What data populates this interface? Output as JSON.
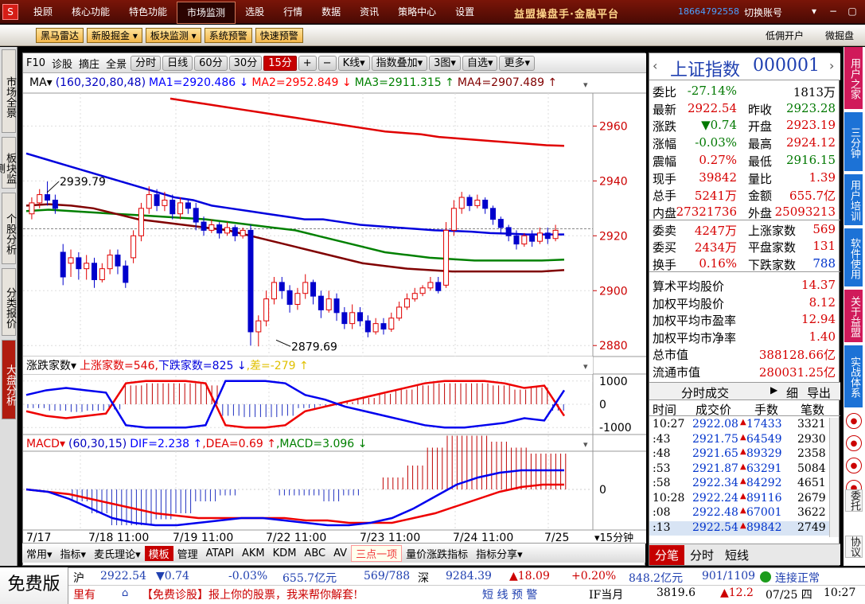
{
  "topbar": {
    "logo": "S",
    "menu": [
      "投顾",
      "核心功能",
      "特色功能",
      "市场监测",
      "选股",
      "行情",
      "数据",
      "资讯",
      "策略中心",
      "设置"
    ],
    "selected": "市场监测",
    "brand": "益盟操盘手·金融平台",
    "phone": "18664792558",
    "switch_account": "切换账号",
    "win": [
      "▾",
      "−",
      "▢",
      "✕"
    ]
  },
  "toolbar2": {
    "buttons": [
      "黑马雷达",
      "新股掘金",
      "板块监测",
      "系统预警",
      "快速预警"
    ],
    "open_account": "低佣开户",
    "weixin": "微掘盘"
  },
  "lefttabs": [
    "市场全景",
    "板块监测",
    "个股分析",
    "分类报价",
    "大盘分析"
  ],
  "righttabs": [
    "用户之家",
    "三分钟",
    "用户培训",
    "软件使用",
    "关于益盟",
    "实战体系"
  ],
  "righticons": [
    "委托",
    "协议"
  ],
  "chartbar": {
    "items": [
      "F10",
      "诊股",
      "摘庄",
      "全景"
    ],
    "periods": [
      "分时",
      "日线",
      "60分",
      "30分",
      "15分"
    ],
    "selected_period": "15分",
    "kline": "K线▾",
    "overlay": "指数叠加▾",
    "figs": "3图▾",
    "custom": "自选▾",
    "more": "更多▾"
  },
  "ma_legend": {
    "prefix": "MA▾",
    "params": "(160,320,80,48)",
    "ma1": "MA1=2920.486 ↓",
    "ma2": "MA2=2952.849 ↓",
    "ma3": "MA3=2911.315 ↑",
    "ma4": "MA4=2907.489 ↑"
  },
  "ind2": {
    "name": "涨跌家数▾",
    "up": "上涨家数=546,",
    "down": "下跌家数=825 ↓",
    "diff": ",差=-279 ↑"
  },
  "ind3": {
    "name": "MACD▾",
    "params": "(60,30,15)",
    "dif": "DIF=2.238 ↑",
    "dea": ",DEA=0.69 ↑",
    "macd": ",MACD=3.096 ↓"
  },
  "yaxis_main": [
    "2960",
    "2940",
    "2920",
    "2900",
    "2880"
  ],
  "yaxis_ind2": [
    "1000",
    "0",
    "-1000"
  ],
  "yaxis_ind3": [
    "0"
  ],
  "xaxis": [
    "7/17",
    "7/18 11:00",
    "7/19 11:00",
    "7/22 11:00",
    "7/23 11:00",
    "7/24 11:00",
    "7/25"
  ],
  "xunit": "▾15分钟",
  "annot_high": "2939.79",
  "annot_low": "2879.69",
  "bottombar": [
    "常用▾",
    "指标▾",
    "麦氏理论▾",
    "模板",
    "管理",
    "ATAPI",
    "AKM",
    "KDM",
    "ABC",
    "AV",
    "三点一项",
    "量价涨跌指标",
    "指标分享▾"
  ],
  "bottombar_selected": "模板",
  "quote": {
    "title": "上证指数",
    "code": "000001",
    "rows": [
      [
        "委比",
        "-27.14%",
        "",
        "1813万"
      ],
      [
        "最新",
        "2922.54",
        "昨收",
        "2923.28"
      ],
      [
        "涨跌",
        "▼0.74",
        "开盘",
        "2923.19"
      ],
      [
        "涨幅",
        "-0.03%",
        "最高",
        "2924.12"
      ],
      [
        "震幅",
        "0.27%",
        "最低",
        "2916.15"
      ],
      [
        "现手",
        "39842",
        "量比",
        "1.39"
      ],
      [
        "总手",
        "5241万",
        "金额",
        "655.7亿"
      ],
      [
        "内盘",
        "27321736",
        "外盘",
        "25093213"
      ],
      [
        "委卖",
        "4247万",
        "上涨家数",
        "569"
      ],
      [
        "委买",
        "2434万",
        "平盘家数",
        "131"
      ],
      [
        "换手",
        "0.16%",
        "下跌家数",
        "788"
      ]
    ],
    "stats": [
      [
        "算术平均股价",
        "14.37"
      ],
      [
        "加权平均股价",
        "8.12"
      ],
      [
        "加权平均市盈率",
        "12.94"
      ],
      [
        "加权平均市净率",
        "1.40"
      ],
      [
        "总市值",
        "388128.66亿"
      ],
      [
        "流通市值",
        "280031.25亿"
      ]
    ],
    "tick_title": "分时成交",
    "tick_tabs": [
      "细",
      "导出"
    ],
    "tick_head": [
      "时间",
      "成交价",
      "手数",
      "笔数"
    ],
    "ticks": [
      [
        "10:27",
        "2922.08",
        "17433",
        "3321"
      ],
      [
        ":43",
        "2921.75",
        "64549",
        "2930"
      ],
      [
        ":48",
        "2921.65",
        "89329",
        "2358"
      ],
      [
        ":53",
        "2921.87",
        "63291",
        "5084"
      ],
      [
        ":58",
        "2922.34",
        "84292",
        "4651"
      ],
      [
        "10:28",
        "2922.24",
        "89116",
        "2679"
      ],
      [
        ":08",
        "2922.48",
        "67001",
        "3622"
      ],
      [
        ":13",
        "2922.54",
        "89842",
        "2749"
      ]
    ],
    "bottom_tabs": [
      "分笔",
      "分时",
      "短线"
    ]
  },
  "statusbar": {
    "free": "免费版",
    "sh_label": "沪",
    "sh_price": "2922.54",
    "sh_chg": "▼0.74",
    "sh_pct": "-0.03%",
    "sh_amt": "655.7亿元",
    "sh_ratio": "569/788",
    "sz_label": "深",
    "sz_price": "9284.39",
    "sz_chg": "▲18.09",
    "sz_pct": "+0.20%",
    "sz_amt": "848.2亿元",
    "sz_ratio": "901/1109",
    "conn": "连接正常",
    "news_pre": "里有",
    "news": "【免费诊股】报上你的股票，我来帮你解套!",
    "short": "短 线 预 警",
    "if_label": "IF当月",
    "if_price": "3819.6",
    "if_chg": "▲12.2",
    "date": "07/25 四",
    "time": "10:27"
  },
  "chart_data": {
    "type": "candlestick",
    "title": "上证指数 000001",
    "period": "15分",
    "xaxis": [
      "7/17",
      "7/18 11:00",
      "7/19 11:00",
      "7/22 11:00",
      "7/23 11:00",
      "7/24 11:00",
      "7/25"
    ],
    "ylim": [
      2876,
      2972
    ],
    "high_annot": 2939.79,
    "low_annot": 2879.69,
    "candles": [
      [
        2928,
        2932,
        2926,
        2934
      ],
      [
        2932,
        2935,
        2930,
        2937
      ],
      [
        2935,
        2933,
        2931,
        2939.79
      ],
      [
        2933,
        2930,
        2928,
        2935
      ],
      [
        2914,
        2905,
        2902,
        2917
      ],
      [
        2910,
        2912,
        2905,
        2915
      ],
      [
        2912,
        2908,
        2904,
        2914
      ],
      [
        2908,
        2910,
        2904,
        2913
      ],
      [
        2910,
        2904,
        2901,
        2912
      ],
      [
        2904,
        2908,
        2903,
        2910
      ],
      [
        2908,
        2913,
        2906,
        2915
      ],
      [
        2913,
        2909,
        2906,
        2915
      ],
      [
        2909,
        2903,
        2901,
        2911
      ],
      [
        2912,
        2920,
        2910,
        2922
      ],
      [
        2920,
        2930,
        2918,
        2932
      ],
      [
        2930,
        2935,
        2928,
        2938
      ],
      [
        2935,
        2931,
        2929,
        2937
      ],
      [
        2931,
        2933,
        2929,
        2936
      ],
      [
        2933,
        2928,
        2926,
        2935
      ],
      [
        2928,
        2932,
        2926,
        2934
      ],
      [
        2932,
        2930,
        2928,
        2933
      ],
      [
        2930,
        2925,
        2922,
        2932
      ],
      [
        2925,
        2922,
        2920,
        2927
      ],
      [
        2922,
        2924,
        2921,
        2926
      ],
      [
        2924,
        2921,
        2919,
        2925
      ],
      [
        2921,
        2923,
        2920,
        2925
      ],
      [
        2923,
        2920,
        2918,
        2924
      ],
      [
        2920,
        2922,
        2919,
        2923
      ],
      [
        2922,
        2885,
        2880,
        2924
      ],
      [
        2885,
        2889,
        2879.69,
        2891
      ],
      [
        2889,
        2897,
        2887,
        2900
      ],
      [
        2897,
        2903,
        2895,
        2905
      ],
      [
        2903,
        2900,
        2897,
        2905
      ],
      [
        2900,
        2895,
        2892,
        2902
      ],
      [
        2895,
        2899,
        2893,
        2901
      ],
      [
        2899,
        2903,
        2897,
        2906
      ],
      [
        2903,
        2898,
        2895,
        2904
      ],
      [
        2898,
        2893,
        2890,
        2900
      ],
      [
        2893,
        2897,
        2892,
        2900
      ],
      [
        2897,
        2892,
        2889,
        2899
      ],
      [
        2892,
        2888,
        2886,
        2894
      ],
      [
        2888,
        2892,
        2886,
        2895
      ],
      [
        2892,
        2889,
        2887,
        2894
      ],
      [
        2889,
        2885,
        2883,
        2891
      ],
      [
        2885,
        2888,
        2884,
        2890
      ],
      [
        2888,
        2886,
        2884,
        2890
      ],
      [
        2886,
        2890,
        2885,
        2892
      ],
      [
        2890,
        2894,
        2889,
        2896
      ],
      [
        2894,
        2897,
        2893,
        2899
      ],
      [
        2897,
        2899,
        2896,
        2901
      ],
      [
        2899,
        2901,
        2898,
        2902
      ],
      [
        2901,
        2903,
        2900,
        2905
      ],
      [
        2903,
        2900,
        2899,
        2905
      ],
      [
        2902,
        2922,
        2901,
        2925
      ],
      [
        2922,
        2930,
        2920,
        2933
      ],
      [
        2930,
        2934,
        2928,
        2936
      ],
      [
        2934,
        2931,
        2929,
        2935
      ],
      [
        2931,
        2933,
        2930,
        2935
      ],
      [
        2933,
        2930,
        2928,
        2934
      ],
      [
        2930,
        2926,
        2924,
        2931
      ],
      [
        2926,
        2923,
        2921,
        2927
      ],
      [
        2923,
        2920,
        2918,
        2924
      ],
      [
        2920,
        2917,
        2915,
        2922
      ],
      [
        2917,
        2920,
        2916,
        2921
      ],
      [
        2920,
        2918,
        2916,
        2922
      ],
      [
        2918,
        2921,
        2917,
        2923
      ],
      [
        2921,
        2919,
        2917,
        2923
      ],
      [
        2919,
        2922,
        2918,
        2924
      ]
    ],
    "ma1": [
      2950,
      2948,
      2946,
      2944,
      2942,
      2940,
      2938,
      2936,
      2934,
      2933,
      2931,
      2930,
      2929,
      2928,
      2927,
      2926,
      2926,
      2925,
      2924,
      2923.5,
      2923,
      2922.5,
      2922,
      2921.8,
      2921.5,
      2921,
      2920.8,
      2920.5,
      2920.5,
      2920.5
    ],
    "ma2": [
      2970,
      2969,
      2968,
      2967,
      2966,
      2965,
      2964,
      2963,
      2962,
      2961,
      2960,
      2959,
      2958,
      2957.5,
      2957,
      2956,
      2955.5,
      2955,
      2954.5,
      2954,
      2953.5,
      2953,
      2952.8
    ],
    "ma3": [
      2929,
      2929.5,
      2929,
      2928.5,
      2928,
      2927.5,
      2927,
      2926.5,
      2926,
      2925,
      2924,
      2923,
      2922,
      2920,
      2918,
      2916,
      2914,
      2913,
      2912,
      2911.5,
      2911,
      2911,
      2911,
      2911,
      2911.3
    ],
    "ma4": [
      2931,
      2931.5,
      2931,
      2930,
      2928,
      2926,
      2925,
      2924,
      2923,
      2922,
      2920,
      2918,
      2916,
      2914,
      2912,
      2910,
      2909,
      2908,
      2907.5,
      2907,
      2907,
      2907,
      2907,
      2907,
      2907.5
    ],
    "ind2": {
      "up": [
        -300,
        -500,
        -600,
        -500,
        -400,
        900,
        1000,
        1000,
        1000,
        900,
        -900,
        -1000,
        -1000,
        -900,
        -300,
        -100,
        100,
        300,
        500,
        700,
        900,
        1000,
        1000,
        1000,
        900,
        700,
        800,
        -500
      ],
      "down": [
        400,
        600,
        700,
        600,
        500,
        -900,
        -1000,
        -1000,
        -1000,
        -900,
        1000,
        1000,
        1000,
        900,
        400,
        200,
        -100,
        -300,
        -500,
        -700,
        -900,
        -1000,
        -1000,
        -900,
        -800,
        -600,
        -700,
        600
      ],
      "ylim": [
        -1300,
        1300
      ]
    },
    "macd": {
      "dif": [
        0,
        -1,
        -4,
        -8,
        -12,
        -14,
        -15,
        -15,
        -14,
        -13,
        -12,
        -12,
        -13,
        -14,
        -15,
        -15,
        -14,
        -12,
        -8,
        -3,
        2,
        5,
        7,
        8,
        8,
        8
      ],
      "dea": [
        0,
        -1,
        -2,
        -4,
        -6,
        -8,
        -10,
        -11,
        -12,
        -12,
        -12,
        -12,
        -12,
        -13,
        -13,
        -14,
        -14,
        -14,
        -12,
        -10,
        -7,
        -4,
        -1,
        1,
        2,
        2
      ],
      "ylim": [
        -17,
        16
      ]
    }
  }
}
